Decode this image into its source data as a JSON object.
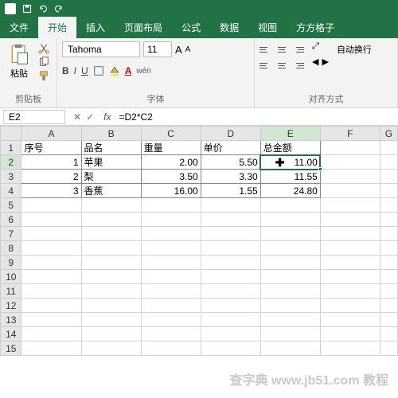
{
  "tabs": {
    "file": "文件",
    "home": "开始",
    "insert": "插入",
    "layout": "页面布局",
    "formulas": "公式",
    "data": "数据",
    "view": "视图",
    "square": "方方格子"
  },
  "ribbon": {
    "paste_label": "粘贴",
    "clipboard_group": "剪贴板",
    "font_name": "Tahoma",
    "font_size": "11",
    "font_group": "字体",
    "wrap_label": "自动换行",
    "align_group": "对齐方式",
    "bold": "B",
    "italic": "I",
    "underline": "U",
    "aa_large": "A",
    "aa_small": "A",
    "wen": "wén"
  },
  "namebox": "E2",
  "formula": "=D2*C2",
  "fx": "fx",
  "colheaders": [
    "A",
    "B",
    "C",
    "D",
    "E",
    "F",
    "G"
  ],
  "rowheaders": [
    "1",
    "2",
    "3",
    "4",
    "5",
    "6",
    "7",
    "8",
    "9",
    "10",
    "11",
    "12",
    "13",
    "14",
    "15"
  ],
  "data": {
    "header": {
      "a": "序号",
      "b": "品名",
      "c": "重量",
      "d": "单价",
      "e": "总金额"
    },
    "rows": [
      {
        "a": "1",
        "b": "苹果",
        "c": "2.00",
        "d": "5.50",
        "e": "11.00"
      },
      {
        "a": "2",
        "b": "梨",
        "c": "3.50",
        "d": "3.30",
        "e": "11.55"
      },
      {
        "a": "3",
        "b": "香蕉",
        "c": "16.00",
        "d": "1.55",
        "e": "24.80"
      }
    ]
  },
  "watermark": "查字典 www.jb51.com 教程",
  "chart_data": {
    "type": "table",
    "title": "",
    "columns": [
      "序号",
      "品名",
      "重量",
      "单价",
      "总金额"
    ],
    "rows": [
      [
        1,
        "苹果",
        2.0,
        5.5,
        11.0
      ],
      [
        2,
        "梨",
        3.5,
        3.3,
        11.55
      ],
      [
        3,
        "香蕉",
        16.0,
        1.55,
        24.8
      ]
    ]
  }
}
